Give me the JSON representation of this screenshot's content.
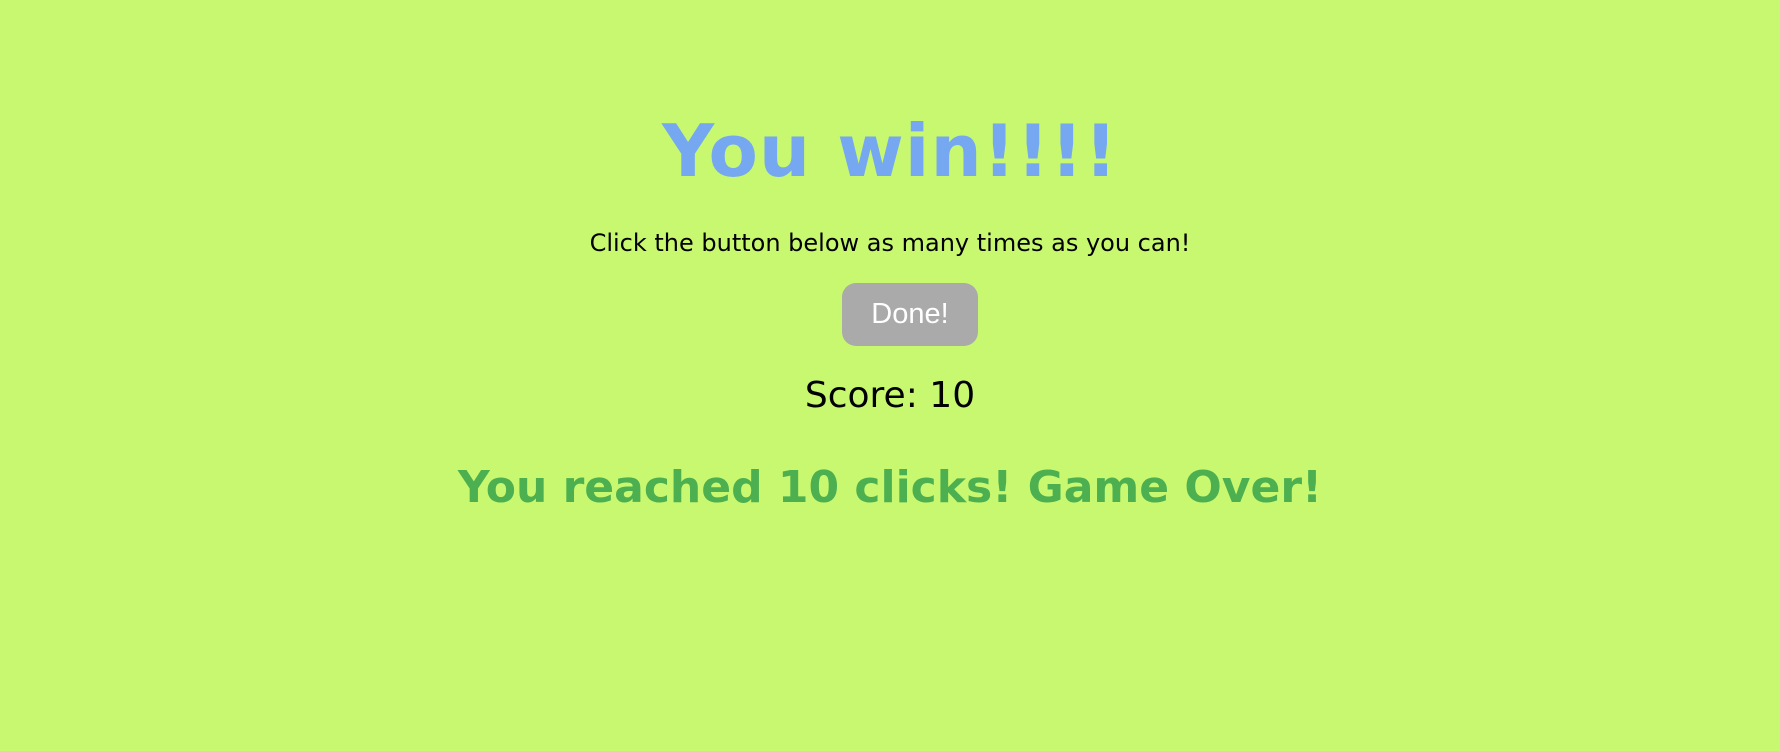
{
  "game": {
    "title": "You win!!!!",
    "instructions": "Click the button below as many times as you can!",
    "button_label": "Done!",
    "score_label": "Score:",
    "score_value": "10",
    "result_message": "You reached 10 clicks! Game Over!"
  },
  "colors": {
    "background": "#c8f870",
    "title": "#75a8f0",
    "button_background": "#aaaaaa",
    "button_text": "#ffffff",
    "result_message": "#4caf50",
    "text": "#000000"
  }
}
